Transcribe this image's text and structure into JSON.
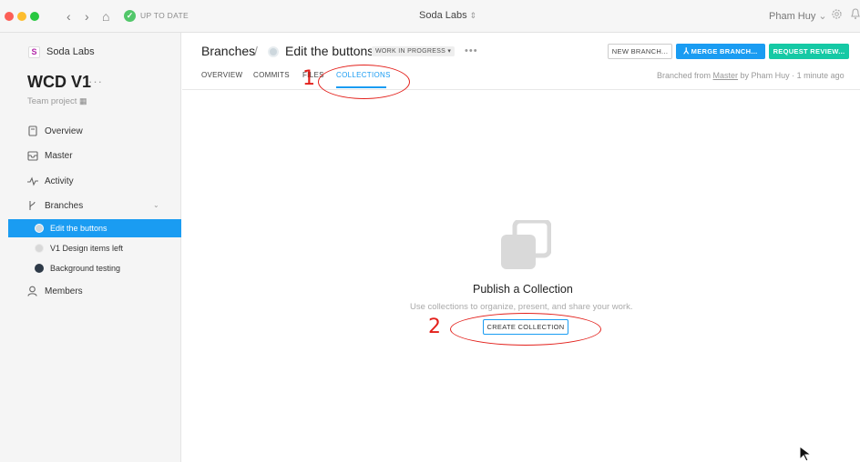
{
  "titlebar": {
    "nav_back": "‹",
    "nav_forward": "›",
    "home_icon": "⌂",
    "sync_status": "UP TO DATE",
    "app_title": "Soda Labs",
    "user_name": "Pham Huy",
    "user_caret": "⌄",
    "settings_icon": "gear-icon",
    "bell_icon": "bell-icon"
  },
  "sidebar": {
    "org_logo": "S",
    "org_name": "Soda Labs",
    "project_name": "WCD V1",
    "project_more": "···",
    "project_type": "Team project",
    "nav": [
      {
        "label": "Overview",
        "icon": "document-icon"
      },
      {
        "label": "Master",
        "icon": "inbox-icon"
      },
      {
        "label": "Activity",
        "icon": "pulse-icon"
      },
      {
        "label": "Branches",
        "icon": "branch-icon"
      },
      {
        "label": "Members",
        "icon": "person-icon"
      }
    ],
    "branches": [
      {
        "label": "Edit the buttons",
        "active": true,
        "color": "#cfd8de"
      },
      {
        "label": "V1 Design items left",
        "active": false,
        "color": "#d8d8d8"
      },
      {
        "label": "Background testing",
        "active": false,
        "color": "#2e3a48"
      }
    ]
  },
  "header": {
    "breadcrumb_root": "Branches",
    "breadcrumb_sep": "/",
    "branch_title": "Edit the buttons",
    "status_badge": "WORK IN PROGRESS ▾",
    "more": "•••",
    "btn_new_branch": "NEW BRANCH...",
    "btn_merge_branch": "MERGE BRANCH...",
    "btn_request_review": "REQUEST REVIEW...",
    "branched_prefix": "Branched from ",
    "branched_link": "Master",
    "branched_suffix": " by Pham Huy · 1 minute ago",
    "tabs": [
      {
        "label": "OVERVIEW"
      },
      {
        "label": "COMMITS"
      },
      {
        "label": "FILES"
      },
      {
        "label": "COLLECTIONS",
        "active": true
      }
    ]
  },
  "empty_state": {
    "icon": "collection-icon",
    "title": "Publish a Collection",
    "description": "Use collections to organize, present, and share your work.",
    "button": "CREATE COLLECTION"
  },
  "annotations": {
    "step1": "1",
    "step2": "2",
    "color": "#e3201b"
  },
  "colors": {
    "accent": "#1a9cf2",
    "review_green": "#15c9a5",
    "sync_green": "#52c76a"
  }
}
